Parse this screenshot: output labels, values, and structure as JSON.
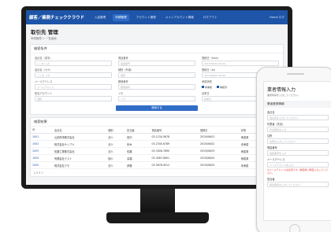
{
  "app": {
    "title": "顧客／業務チェッククラウド",
    "nav": [
      "入金管理",
      "申請管理",
      "アカウント管理",
      "メインアカウント情報",
      "ログアウト"
    ],
    "user": "Home ログ"
  },
  "page": {
    "title": "取引先 管理",
    "breadcrumb": "申請管理 ＞ 一覧画面"
  },
  "search": {
    "heading": "検索条件",
    "fields": [
      {
        "label": "会社名（漢字）",
        "placeholder": "ここを 入力"
      },
      {
        "label": "電話番号",
        "placeholder": "電話番号"
      },
      {
        "label": "登録日（from）",
        "placeholder": "2015/06/01 00:00"
      },
      {
        "label": "会社名（カナ）",
        "placeholder": "ここを 入力"
      },
      {
        "label": "種別（外部）",
        "placeholder": "選択"
      },
      {
        "label": "登録日（to）",
        "placeholder": "2015/06/01 00:00"
      },
      {
        "label": "メールアドレス",
        "placeholder": "メールアドレス"
      },
      {
        "label": "郵便番号",
        "placeholder": "郵便番号"
      },
      {
        "label": "承認状態",
        "checks": [
          "未承認",
          "承認済"
        ]
      },
      {
        "label": "担当アカウント",
        "placeholder": "選択"
      },
      {
        "label": "メモ",
        "placeholder": "メモ"
      },
      {
        "label": "請求日",
        "placeholder": "請求日"
      }
    ],
    "button": "検索する"
  },
  "results": {
    "heading": "検索結果",
    "columns": [
      "ID",
      "会社名",
      "種別",
      "担当者",
      "電話番号",
      "登録日",
      "状態",
      "操作"
    ],
    "rows": [
      [
        "1001",
        "山田商事株式会社",
        "法人",
        "田中",
        "03-1234-5678",
        "2015/06/01",
        "承認済",
        "詳細"
      ],
      [
        "1002",
        "株式会社サンプル",
        "法人",
        "鈴木",
        "03-2345-6789",
        "2015/06/02",
        "未承認",
        "詳細"
      ],
      [
        "1003",
        "佐藤工業株式会社",
        "法人",
        "佐藤",
        "03-3456-7890",
        "2015/06/03",
        "承認済",
        "詳細"
      ],
      [
        "1004",
        "有限会社テスト",
        "個人",
        "高橋",
        "03-4567-8901",
        "2015/06/04",
        "承認済",
        "詳細"
      ],
      [
        "1005",
        "株式会社デモ",
        "法人",
        "伊藤",
        "03-5678-9012",
        "2015/06/05",
        "未承認",
        "詳細"
      ]
    ],
    "pagination": "1 2 3 ＞"
  },
  "mobile": {
    "title": "業者情報入力",
    "subtitle": "業者情報を入力してください。",
    "section": "業者登録情報",
    "fields": [
      {
        "label": "会社名",
        "placeholder": "会社名を入力してください"
      },
      {
        "label": "代表者（氏名）",
        "placeholder": "代表者名を入力"
      },
      {
        "label": "住所",
        "placeholder": "住所を入力してください"
      },
      {
        "label": "電話番号",
        "placeholder": "電話番号を入力"
      },
      {
        "label": "メールアドレス",
        "placeholder": "メールアドレスを入力"
      }
    ],
    "note": "※メールアドレスは必須です。確認用に再度入力してください。",
    "last_field": {
      "label": "担当者",
      "placeholder": "担当者名を入力してください"
    }
  }
}
